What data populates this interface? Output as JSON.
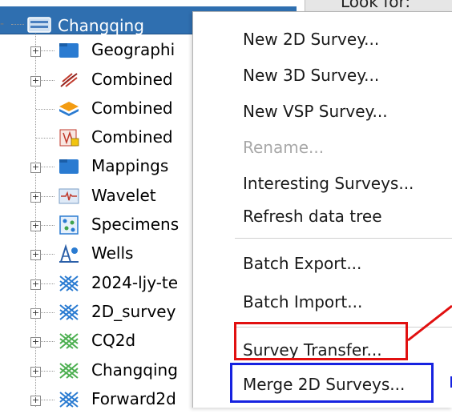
{
  "search": {
    "label": "Look for:"
  },
  "tree": {
    "root": {
      "label": "Changqing",
      "expander": "-"
    },
    "items": [
      {
        "label": "Geographi",
        "icon": "folder-icon",
        "expander": "+"
      },
      {
        "label": "Combined",
        "icon": "combined-lines-icon",
        "expander": "+"
      },
      {
        "label": "Combined",
        "icon": "layers-icon",
        "expander": ""
      },
      {
        "label": "Combined",
        "icon": "combined-grid-icon",
        "expander": ""
      },
      {
        "label": "Mappings",
        "icon": "folder-icon",
        "expander": "+"
      },
      {
        "label": "Wavelet",
        "icon": "wavelet-icon",
        "expander": "+"
      },
      {
        "label": "Specimens",
        "icon": "specimens-icon",
        "expander": "+"
      },
      {
        "label": "Wells",
        "icon": "wells-icon",
        "expander": "+"
      },
      {
        "label": "2024-ljy-te",
        "icon": "survey-icon",
        "expander": "+"
      },
      {
        "label": "2D_survey",
        "icon": "survey-icon",
        "expander": "+"
      },
      {
        "label": "CQ2d",
        "icon": "survey-icon",
        "expander": "+"
      },
      {
        "label": "Changqing",
        "icon": "survey-icon",
        "expander": "+"
      },
      {
        "label": "Forward2d",
        "icon": "survey-icon",
        "expander": "+"
      }
    ]
  },
  "context_menu": {
    "items": [
      {
        "label": "New 2D Survey...",
        "enabled": true
      },
      {
        "label": "New 3D Survey...",
        "enabled": true
      },
      {
        "label": "New VSP Survey...",
        "enabled": true
      },
      {
        "label": "Rename...",
        "enabled": false
      },
      {
        "label": "Interesting Surveys...",
        "enabled": true
      },
      {
        "label": "Refresh data tree",
        "enabled": true
      },
      {
        "label": "Batch Export...",
        "enabled": true
      },
      {
        "label": "Batch Import...",
        "enabled": true
      },
      {
        "label": "Survey Transfer...",
        "enabled": true
      },
      {
        "label": "Merge 2D Surveys...",
        "enabled": true
      }
    ]
  },
  "colors": {
    "selection": "#2f6fb0",
    "highlight_red": "#e11010",
    "highlight_blue": "#1622e0",
    "disabled_text": "#a8a8a8"
  }
}
